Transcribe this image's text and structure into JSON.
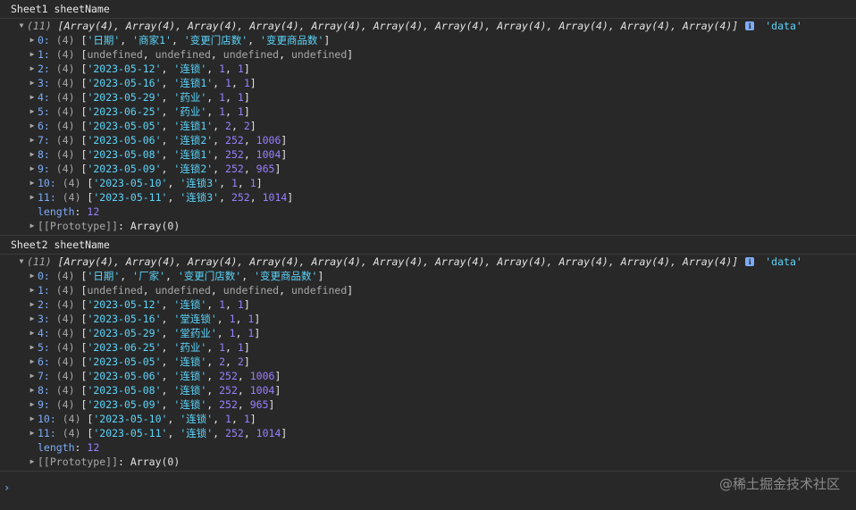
{
  "sheets": [
    {
      "label": "Sheet1 sheetName",
      "summary_count": "(11)",
      "summary_items": "[Array(4), Array(4), Array(4), Array(4), Array(4), Array(4), Array(4), Array(4), Array(4), Array(4), Array(4)]",
      "summary_tag": "'data'",
      "rows": [
        {
          "index": "0:",
          "count": "(4)",
          "values": [
            {
              "t": "str",
              "v": "'日期'"
            },
            {
              "t": "str",
              "v": "'商家1'"
            },
            {
              "t": "str",
              "v": "'变更门店数'"
            },
            {
              "t": "str",
              "v": "'变更商品数'"
            }
          ]
        },
        {
          "index": "1:",
          "count": "(4)",
          "values": [
            {
              "t": "undef",
              "v": "undefined"
            },
            {
              "t": "undef",
              "v": "undefined"
            },
            {
              "t": "undef",
              "v": "undefined"
            },
            {
              "t": "undef",
              "v": "undefined"
            }
          ]
        },
        {
          "index": "2:",
          "count": "(4)",
          "values": [
            {
              "t": "str",
              "v": "'2023-05-12'"
            },
            {
              "t": "str",
              "v": "'连锁'"
            },
            {
              "t": "num",
              "v": "1"
            },
            {
              "t": "num",
              "v": "1"
            }
          ]
        },
        {
          "index": "3:",
          "count": "(4)",
          "values": [
            {
              "t": "str",
              "v": "'2023-05-16'"
            },
            {
              "t": "str",
              "v": "'连锁1'"
            },
            {
              "t": "num",
              "v": "1"
            },
            {
              "t": "num",
              "v": "1"
            }
          ]
        },
        {
          "index": "4:",
          "count": "(4)",
          "values": [
            {
              "t": "str",
              "v": "'2023-05-29'"
            },
            {
              "t": "str",
              "v": "'药业'"
            },
            {
              "t": "num",
              "v": "1"
            },
            {
              "t": "num",
              "v": "1"
            }
          ]
        },
        {
          "index": "5:",
          "count": "(4)",
          "values": [
            {
              "t": "str",
              "v": "'2023-06-25'"
            },
            {
              "t": "str",
              "v": "'药业'"
            },
            {
              "t": "num",
              "v": "1"
            },
            {
              "t": "num",
              "v": "1"
            }
          ]
        },
        {
          "index": "6:",
          "count": "(4)",
          "values": [
            {
              "t": "str",
              "v": "'2023-05-05'"
            },
            {
              "t": "str",
              "v": "'连锁1'"
            },
            {
              "t": "num",
              "v": "2"
            },
            {
              "t": "num",
              "v": "2"
            }
          ]
        },
        {
          "index": "7:",
          "count": "(4)",
          "values": [
            {
              "t": "str",
              "v": "'2023-05-06'"
            },
            {
              "t": "str",
              "v": "'连锁2'"
            },
            {
              "t": "num",
              "v": "252"
            },
            {
              "t": "num",
              "v": "1006"
            }
          ]
        },
        {
          "index": "8:",
          "count": "(4)",
          "values": [
            {
              "t": "str",
              "v": "'2023-05-08'"
            },
            {
              "t": "str",
              "v": "'连锁1'"
            },
            {
              "t": "num",
              "v": "252"
            },
            {
              "t": "num",
              "v": "1004"
            }
          ]
        },
        {
          "index": "9:",
          "count": "(4)",
          "values": [
            {
              "t": "str",
              "v": "'2023-05-09'"
            },
            {
              "t": "str",
              "v": "'连锁2'"
            },
            {
              "t": "num",
              "v": "252"
            },
            {
              "t": "num",
              "v": "965"
            }
          ]
        },
        {
          "index": "10:",
          "count": "(4)",
          "values": [
            {
              "t": "str",
              "v": "'2023-05-10'"
            },
            {
              "t": "str",
              "v": "'连锁3'"
            },
            {
              "t": "num",
              "v": "1"
            },
            {
              "t": "num",
              "v": "1"
            }
          ]
        },
        {
          "index": "11:",
          "count": "(4)",
          "values": [
            {
              "t": "str",
              "v": "'2023-05-11'"
            },
            {
              "t": "str",
              "v": "'连锁3'"
            },
            {
              "t": "num",
              "v": "252"
            },
            {
              "t": "num",
              "v": "1014"
            }
          ]
        }
      ],
      "length_key": "length",
      "length_value": "12",
      "prototype_key": "[[Prototype]]",
      "prototype_value": "Array(0)"
    },
    {
      "label": "Sheet2 sheetName",
      "summary_count": "(11)",
      "summary_items": "[Array(4), Array(4), Array(4), Array(4), Array(4), Array(4), Array(4), Array(4), Array(4), Array(4), Array(4)]",
      "summary_tag": "'data'",
      "rows": [
        {
          "index": "0:",
          "count": "(4)",
          "values": [
            {
              "t": "str",
              "v": "'日期'"
            },
            {
              "t": "str",
              "v": "'厂家'"
            },
            {
              "t": "str",
              "v": "'变更门店数'"
            },
            {
              "t": "str",
              "v": "'变更商品数'"
            }
          ]
        },
        {
          "index": "1:",
          "count": "(4)",
          "values": [
            {
              "t": "undef",
              "v": "undefined"
            },
            {
              "t": "undef",
              "v": "undefined"
            },
            {
              "t": "undef",
              "v": "undefined"
            },
            {
              "t": "undef",
              "v": "undefined"
            }
          ]
        },
        {
          "index": "2:",
          "count": "(4)",
          "values": [
            {
              "t": "str",
              "v": "'2023-05-12'"
            },
            {
              "t": "str",
              "v": "'连锁'"
            },
            {
              "t": "num",
              "v": "1"
            },
            {
              "t": "num",
              "v": "1"
            }
          ]
        },
        {
          "index": "3:",
          "count": "(4)",
          "values": [
            {
              "t": "str",
              "v": "'2023-05-16'"
            },
            {
              "t": "str",
              "v": "'堂连锁'"
            },
            {
              "t": "num",
              "v": "1"
            },
            {
              "t": "num",
              "v": "1"
            }
          ]
        },
        {
          "index": "4:",
          "count": "(4)",
          "values": [
            {
              "t": "str",
              "v": "'2023-05-29'"
            },
            {
              "t": "str",
              "v": "'堂药业'"
            },
            {
              "t": "num",
              "v": "1"
            },
            {
              "t": "num",
              "v": "1"
            }
          ]
        },
        {
          "index": "5:",
          "count": "(4)",
          "values": [
            {
              "t": "str",
              "v": "'2023-06-25'"
            },
            {
              "t": "str",
              "v": "'药业'"
            },
            {
              "t": "num",
              "v": "1"
            },
            {
              "t": "num",
              "v": "1"
            }
          ]
        },
        {
          "index": "6:",
          "count": "(4)",
          "values": [
            {
              "t": "str",
              "v": "'2023-05-05'"
            },
            {
              "t": "str",
              "v": "'连锁'"
            },
            {
              "t": "num",
              "v": "2"
            },
            {
              "t": "num",
              "v": "2"
            }
          ]
        },
        {
          "index": "7:",
          "count": "(4)",
          "values": [
            {
              "t": "str",
              "v": "'2023-05-06'"
            },
            {
              "t": "str",
              "v": "'连锁'"
            },
            {
              "t": "num",
              "v": "252"
            },
            {
              "t": "num",
              "v": "1006"
            }
          ]
        },
        {
          "index": "8:",
          "count": "(4)",
          "values": [
            {
              "t": "str",
              "v": "'2023-05-08'"
            },
            {
              "t": "str",
              "v": "'连锁'"
            },
            {
              "t": "num",
              "v": "252"
            },
            {
              "t": "num",
              "v": "1004"
            }
          ]
        },
        {
          "index": "9:",
          "count": "(4)",
          "values": [
            {
              "t": "str",
              "v": "'2023-05-09'"
            },
            {
              "t": "str",
              "v": "'连锁'"
            },
            {
              "t": "num",
              "v": "252"
            },
            {
              "t": "num",
              "v": "965"
            }
          ]
        },
        {
          "index": "10:",
          "count": "(4)",
          "values": [
            {
              "t": "str",
              "v": "'2023-05-10'"
            },
            {
              "t": "str",
              "v": "'连锁'"
            },
            {
              "t": "num",
              "v": "1"
            },
            {
              "t": "num",
              "v": "1"
            }
          ]
        },
        {
          "index": "11:",
          "count": "(4)",
          "values": [
            {
              "t": "str",
              "v": "'2023-05-11'"
            },
            {
              "t": "str",
              "v": "'连锁'"
            },
            {
              "t": "num",
              "v": "252"
            },
            {
              "t": "num",
              "v": "1014"
            }
          ]
        }
      ],
      "length_key": "length",
      "length_value": "12",
      "prototype_key": "[[Prototype]]",
      "prototype_value": "Array(0)"
    }
  ],
  "prompt_icon": "chevron-right-icon",
  "prompt_glyph": "›",
  "watermark": "@稀土掘金技术社区",
  "colors": {
    "background": "#282828",
    "index_key": "#7cacf8",
    "string": "#5cd5fb",
    "number": "#9980ff",
    "undefined": "#a8a8a8"
  }
}
